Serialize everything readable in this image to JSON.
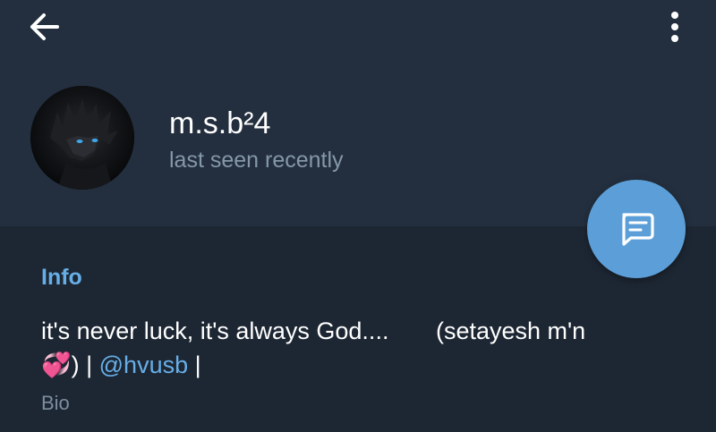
{
  "header": {
    "back_icon": "arrow-left-icon",
    "menu_icon": "more-vertical-icon"
  },
  "profile": {
    "name": "m.s.b²4",
    "status": "last seen recently",
    "avatar_icon": "profile-photo"
  },
  "fab": {
    "icon": "message-icon",
    "color": "#5c9fd8"
  },
  "info": {
    "title": "Info",
    "bio_line1": "it's never luck, it's always God....       (setayesh m'n",
    "bio_emoji": "💞",
    "bio_sep1": ") | ",
    "bio_link": "@hvusb",
    "bio_sep2": " |",
    "bio_label": "Bio"
  },
  "colors": {
    "header_bg": "#232f3e",
    "page_bg": "#1d2733",
    "accent": "#67aee6",
    "muted_text": "#8597a8"
  }
}
